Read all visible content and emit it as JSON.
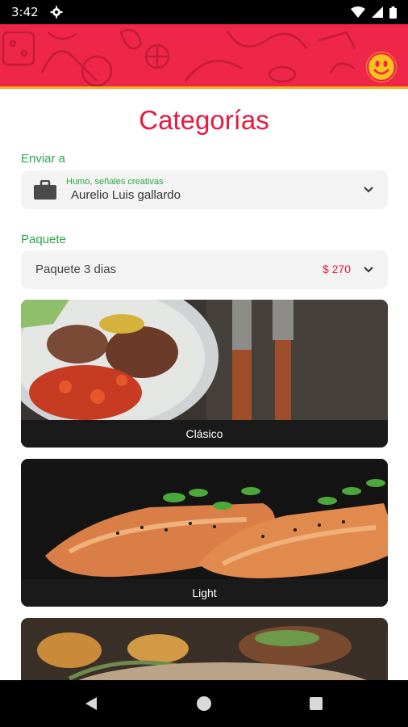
{
  "status_bar": {
    "time": "3:42"
  },
  "page": {
    "title": "Categorías"
  },
  "delivery": {
    "label": "Enviar a",
    "subtitle": "Humo, señales creativas",
    "name": "Aurelio Luis gallardo"
  },
  "package": {
    "label": "Paquete",
    "name": "Paquete 3 dias",
    "price": "$ 270"
  },
  "categories": [
    {
      "label": "Clásico"
    },
    {
      "label": "Light"
    },
    {
      "label": ""
    }
  ],
  "colors": {
    "brand_red": "#ee2649",
    "title_red": "#e8183e",
    "label_green": "#2ca64a",
    "accent_yellow": "#f7c21c"
  }
}
